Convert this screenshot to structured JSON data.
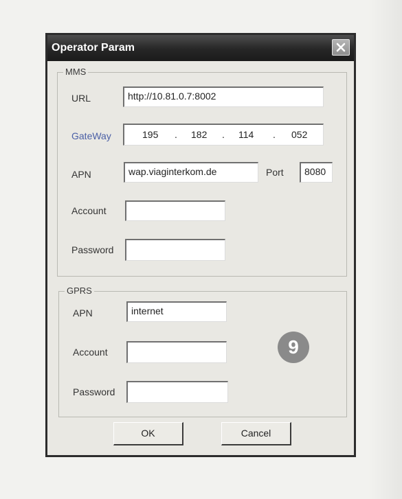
{
  "dialog": {
    "title": "Operator Param",
    "close_icon": "close-icon"
  },
  "mms": {
    "group_label": "MMS",
    "url_label": "URL",
    "url_value": "http://10.81.0.7:8002",
    "gateway_label": "GateWay",
    "gateway_ip": [
      "195",
      "182",
      "114",
      "052"
    ],
    "ip_separator": ".",
    "apn_label": "APN",
    "apn_value": "wap.viaginterkom.de",
    "port_label": "Port",
    "port_value": "8080",
    "account_label": "Account",
    "account_value": "",
    "password_label": "Password",
    "password_value": ""
  },
  "gprs": {
    "group_label": "GPRS",
    "apn_label": "APN",
    "apn_value": "internet",
    "account_label": "Account",
    "account_value": "",
    "password_label": "Password",
    "password_value": ""
  },
  "callout_badge": "9",
  "buttons": {
    "ok_label": "OK",
    "cancel_label": "Cancel"
  },
  "colors": {
    "title_bar": "#262626",
    "gateway_label": "#4a5fa6",
    "badge": "#8a8a8a"
  }
}
